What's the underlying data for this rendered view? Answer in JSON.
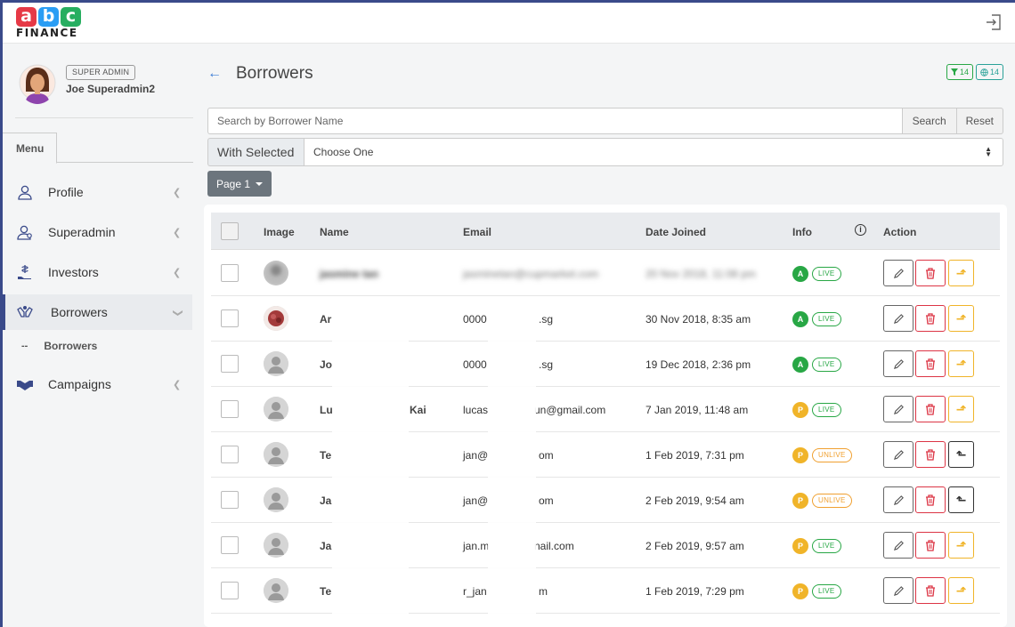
{
  "brand": {
    "letters": [
      "a",
      "b",
      "c"
    ],
    "colors": [
      "#e63946",
      "#2a9df4",
      "#27ae60"
    ],
    "wordmark": "FINANCE"
  },
  "header": {
    "logout_icon": "logout-icon"
  },
  "user": {
    "role": "SUPER ADMIN",
    "name": "Joe Superadmin2"
  },
  "sidebar": {
    "menu_tab": "Menu",
    "items": [
      {
        "label": "Profile",
        "icon": "user-icon"
      },
      {
        "label": "Superadmin",
        "icon": "admin-user-icon"
      },
      {
        "label": "Investors",
        "icon": "money-hand-icon"
      },
      {
        "label": "Borrowers",
        "icon": "hands-icon",
        "active": true
      },
      {
        "label": "Campaigns",
        "icon": "handshake-icon"
      }
    ],
    "sub_items": [
      {
        "dash": "--",
        "label": "Borrowers"
      }
    ]
  },
  "page": {
    "title": "Borrowers",
    "counters": [
      {
        "icon": "filter-icon",
        "value": "14"
      },
      {
        "icon": "globe-icon",
        "value": "14"
      }
    ]
  },
  "search": {
    "placeholder": "Search by Borrower Name",
    "value": "",
    "search_label": "Search",
    "reset_label": "Reset"
  },
  "bulk": {
    "label": "With Selected",
    "selected": "Choose One"
  },
  "pager": {
    "label": "Page 1"
  },
  "table": {
    "columns": [
      "Image",
      "Name",
      "Email",
      "Date Joined",
      "Info",
      "Action"
    ],
    "rows": [
      {
        "name": "jasmine tan",
        "email": "jasminetan@cupmarket.com",
        "date": "20 Nov 2018, 11:08 pm",
        "tier": "A",
        "status": "LIVE",
        "move": "down",
        "blurred": true,
        "image": "blurred-photo"
      },
      {
        "name": "Ar",
        "email": "0000",
        "email_suffix": ".sg",
        "date": "30 Nov 2018, 8:35 am",
        "tier": "A",
        "status": "LIVE",
        "move": "down",
        "image": "food-photo"
      },
      {
        "name": "Jo",
        "email": "0000",
        "email_suffix": ".sg",
        "date": "19 Dec 2018, 2:36 pm",
        "tier": "A",
        "status": "LIVE",
        "move": "down",
        "image": "default-avatar"
      },
      {
        "name": "Lu",
        "name_suffix": "Kai",
        "email": "lucas",
        "email_suffix": "un@gmail.com",
        "date": "7 Jan 2019, 11:48 am",
        "tier": "P",
        "status": "LIVE",
        "move": "down",
        "image": "default-avatar"
      },
      {
        "name": "Te",
        "email": "jan@",
        "email_suffix": "om",
        "date": "1 Feb 2019, 7:31 pm",
        "tier": "P",
        "status": "UNLIVE",
        "move": "up",
        "image": "default-avatar"
      },
      {
        "name": "Ja",
        "email": "jan@",
        "email_suffix": "om",
        "date": "2 Feb 2019, 9:54 am",
        "tier": "P",
        "status": "UNLIVE",
        "move": "up",
        "image": "default-avatar"
      },
      {
        "name": "Ja",
        "email": "jan.m",
        "email_suffix": "nail.com",
        "date": "2 Feb 2019, 9:57 am",
        "tier": "P",
        "status": "LIVE",
        "move": "down",
        "image": "default-avatar"
      },
      {
        "name": "Te",
        "email": "r_jan",
        "email_suffix": "m",
        "date": "1 Feb 2019, 7:29 pm",
        "tier": "P",
        "status": "LIVE",
        "move": "down",
        "image": "default-avatar"
      }
    ]
  }
}
